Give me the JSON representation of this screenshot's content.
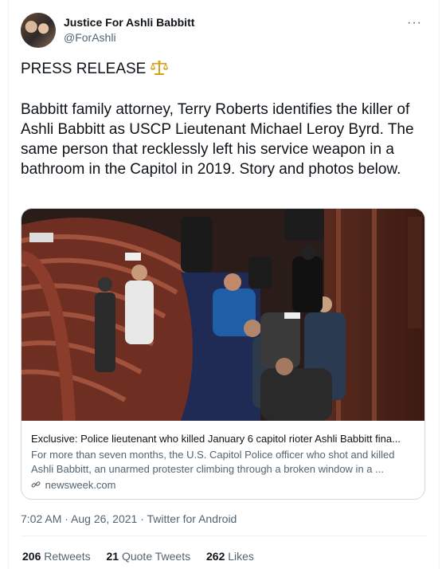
{
  "header": {
    "name": "Justice For Ashli Babbitt",
    "handle": "@ForAshli",
    "more": "···"
  },
  "tweet": {
    "line1": "PRESS RELEASE",
    "body": "Babbitt family attorney, Terry Roberts identifies the killer of Ashli Babbitt as USCP Lieutenant Michael Leroy Byrd. The same person that recklessly left his service weapon in a bathroom in the Capitol in 2019. Story and photos below."
  },
  "card": {
    "title": "Exclusive: Police lieutenant who killed January 6 capitol rioter Ashli Babbitt fina...",
    "description": "For more than seven months, the U.S. Capitol Police officer who shot and killed Ashli Babbitt, an unarmed protester climbing through a broken window in a ...",
    "domain": "newsweek.com"
  },
  "meta": {
    "time": "7:02 AM · Aug 26, 2021 · Twitter for Android"
  },
  "stats": {
    "retweets_count": "206",
    "retweets_label": "Retweets",
    "quotes_count": "21",
    "quotes_label": "Quote Tweets",
    "likes_count": "262",
    "likes_label": "Likes"
  },
  "icons": {
    "header_avatar": "avatar-photo",
    "press_release": "balance-scale-icon",
    "card_link": "link-icon"
  },
  "colors": {
    "text": "#0f1419",
    "secondary": "#536471",
    "border": "#cfd9de",
    "accent_gold": "#d4a017"
  }
}
